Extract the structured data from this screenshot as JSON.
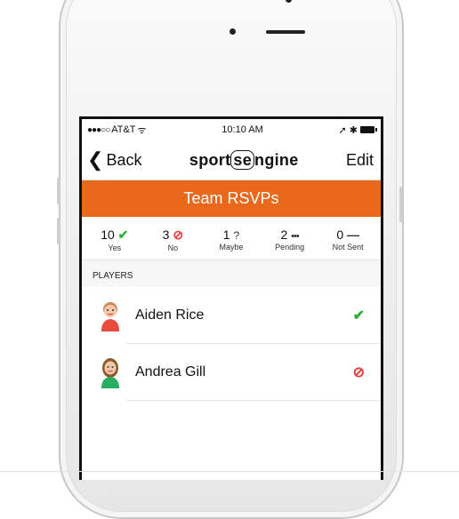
{
  "status_bar": {
    "signal": "●●●○○",
    "carrier": "AT&T",
    "wifi": "ᯤ",
    "time": "10:10 AM",
    "right_icons": "➚ ✱"
  },
  "nav": {
    "back_label": "Back",
    "back_icon": "❮",
    "brand_prefix": "sport",
    "brand_mid": "se",
    "brand_suffix": "ngine",
    "edit_label": "Edit"
  },
  "title": "Team RSVPs",
  "stats": [
    {
      "count": "10",
      "icon": "✔",
      "label": "Yes"
    },
    {
      "count": "3",
      "icon": "⊘",
      "label": "No"
    },
    {
      "count": "1",
      "icon": "?",
      "label": "Maybe"
    },
    {
      "count": "2",
      "icon": "•••",
      "label": "Pending"
    },
    {
      "count": "0",
      "icon": "—",
      "label": "Not Sent"
    }
  ],
  "section_title": "PLAYERS",
  "players": [
    {
      "name": "Aiden Rice",
      "status_icon": "✔",
      "status": "yes"
    },
    {
      "name": "Andrea Gill",
      "status_icon": "⊘",
      "status": "no"
    }
  ],
  "colors": {
    "accent": "#e8691c",
    "yes": "#2fae3a",
    "no": "#e23b3b"
  }
}
